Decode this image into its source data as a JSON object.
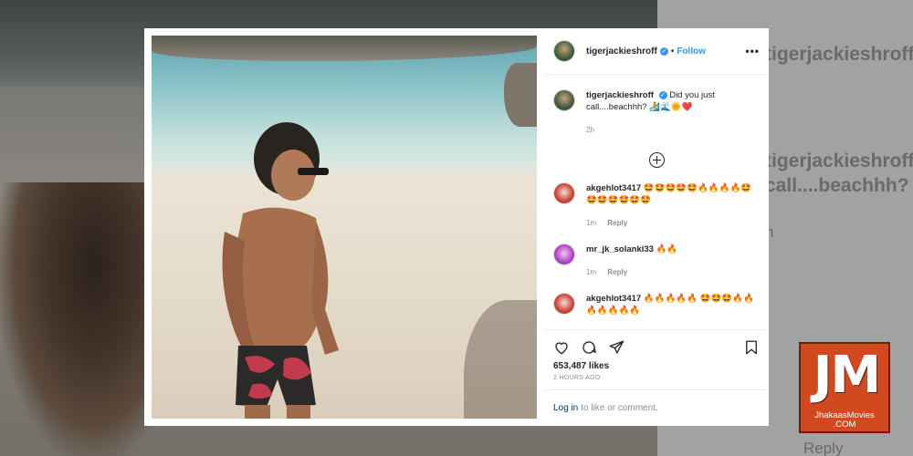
{
  "post": {
    "username": "tigerjackieshroff",
    "verified_mark": "✓",
    "dot": "•",
    "follow_label": "Follow",
    "more_label": "•••",
    "caption_user": "tigerjackieshroff",
    "caption_text": "Did you just call....beachhh? 🏄🌊🌞❤️",
    "caption_time": "2h",
    "load_more_icon": "plus-circle-icon",
    "comments": [
      {
        "user": "akgehlot3417",
        "text": "🤩🤩🤩🤩🤩🔥🔥🔥🔥🤩🤩🤩🤩🤩🤩🤩",
        "time": "1m",
        "reply": "Reply"
      },
      {
        "user": "mr_jk_solanki33",
        "text": "🔥🔥",
        "time": "1m",
        "reply": "Reply"
      },
      {
        "user": "akgehlot3417",
        "text": "🔥🔥🔥🔥🔥 🤩🤩🤩🔥🔥🔥🔥🔥🔥🔥",
        "time": "",
        "reply": ""
      }
    ],
    "likes": "653,487 likes",
    "posted": "2 HOURS AGO",
    "login_link": "Log in",
    "login_rest": "to like or comment."
  },
  "background": {
    "blur_username": "tigerjackieshroff",
    "blur_caption": "call....beachhh?",
    "blur_time": "h",
    "blur_reply": "Reply"
  },
  "watermark": {
    "logo": "JM",
    "line1": "JhakaasMovies",
    "line2": ".COM"
  },
  "colors": {
    "accent": "#3897f0",
    "text": "#262626",
    "muted": "#8e8e8e",
    "logo_bg": "#d3491f"
  }
}
